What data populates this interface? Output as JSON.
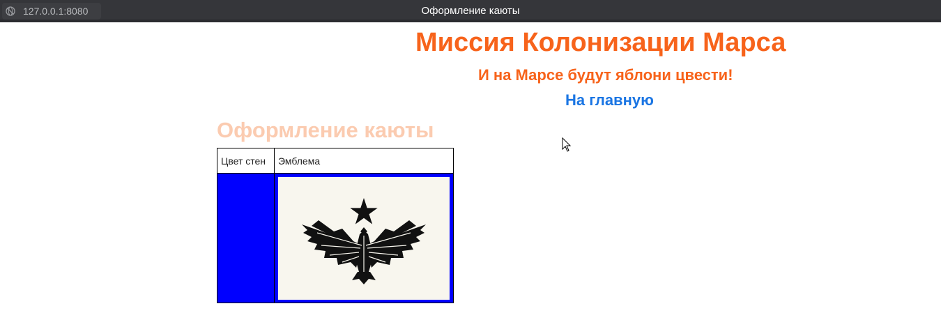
{
  "browser": {
    "url": "127.0.0.1:8080",
    "tab_title": "Оформление каюты"
  },
  "header": {
    "title": "Миссия Колонизации Марса",
    "subtitle": "И на Марсе будут яблони цвести!",
    "home_link": "На главную"
  },
  "section": {
    "title": "Оформление каюты"
  },
  "table": {
    "headers": [
      "Цвет стен",
      "Эмблема"
    ],
    "wall_color": "#0000ff",
    "emblem_icon": "eagle-star-icon"
  },
  "colors": {
    "accent": "#f7631b",
    "link": "#1a75e3",
    "section_title": "#fbcbb0"
  }
}
